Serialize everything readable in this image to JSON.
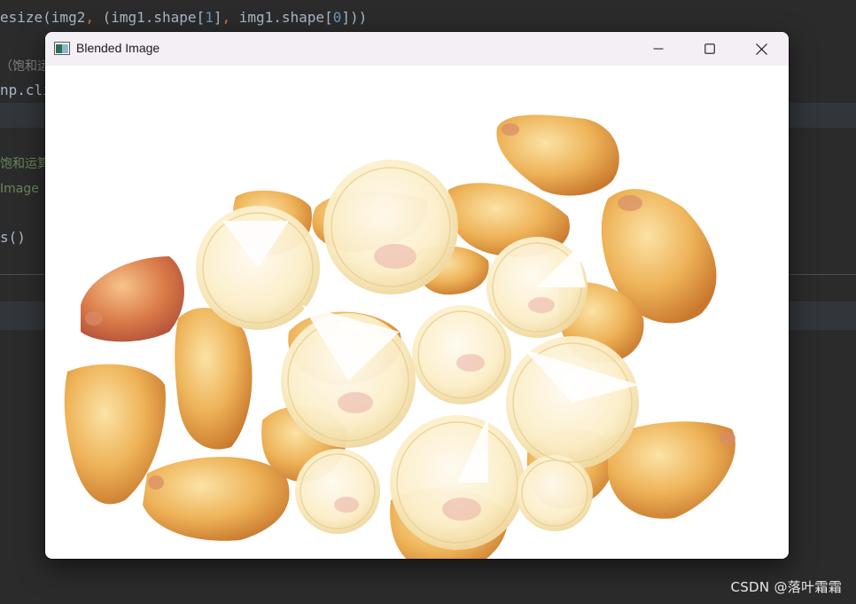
{
  "editor": {
    "lines": [
      {
        "parts": [
          {
            "t": "esize(img2",
            "c": "plain"
          },
          {
            "t": ", ",
            "c": "punct"
          },
          {
            "t": "(img1.shape[",
            "c": "plain"
          },
          {
            "t": "1",
            "c": "num"
          },
          {
            "t": "]",
            "c": "plain"
          },
          {
            "t": ", ",
            "c": "punct"
          },
          {
            "t": "img1.shape[",
            "c": "plain"
          },
          {
            "t": "0",
            "c": "num"
          },
          {
            "t": "]))",
            "c": "plain"
          }
        ]
      },
      {
        "parts": [
          {
            "t": "（饱和运",
            "c": "comment"
          }
        ]
      },
      {
        "parts": [
          {
            "t": "np.cli",
            "c": "plain"
          }
        ]
      },
      {
        "parts": [
          {
            "t": "饱和运算",
            "c": "green"
          }
        ]
      },
      {
        "parts": [
          {
            "t": "Image",
            "c": "green"
          }
        ]
      },
      {
        "parts": [
          {
            "t": "s()",
            "c": "plain"
          }
        ]
      }
    ]
  },
  "window": {
    "title": "Blended Image",
    "icon": "opencv-window-icon",
    "controls": [
      "minimize-icon",
      "maximize-icon",
      "close-icon"
    ]
  },
  "image": {
    "description_name": "corn-kernels-and-coins-blend"
  },
  "watermark": "CSDN @落叶霜霜",
  "colors": {
    "editor_bg": "#2b2b2b",
    "titlebar_bg": "#f4eef5",
    "kernel": "#e8a94a",
    "coin": "#f7e6b2"
  }
}
